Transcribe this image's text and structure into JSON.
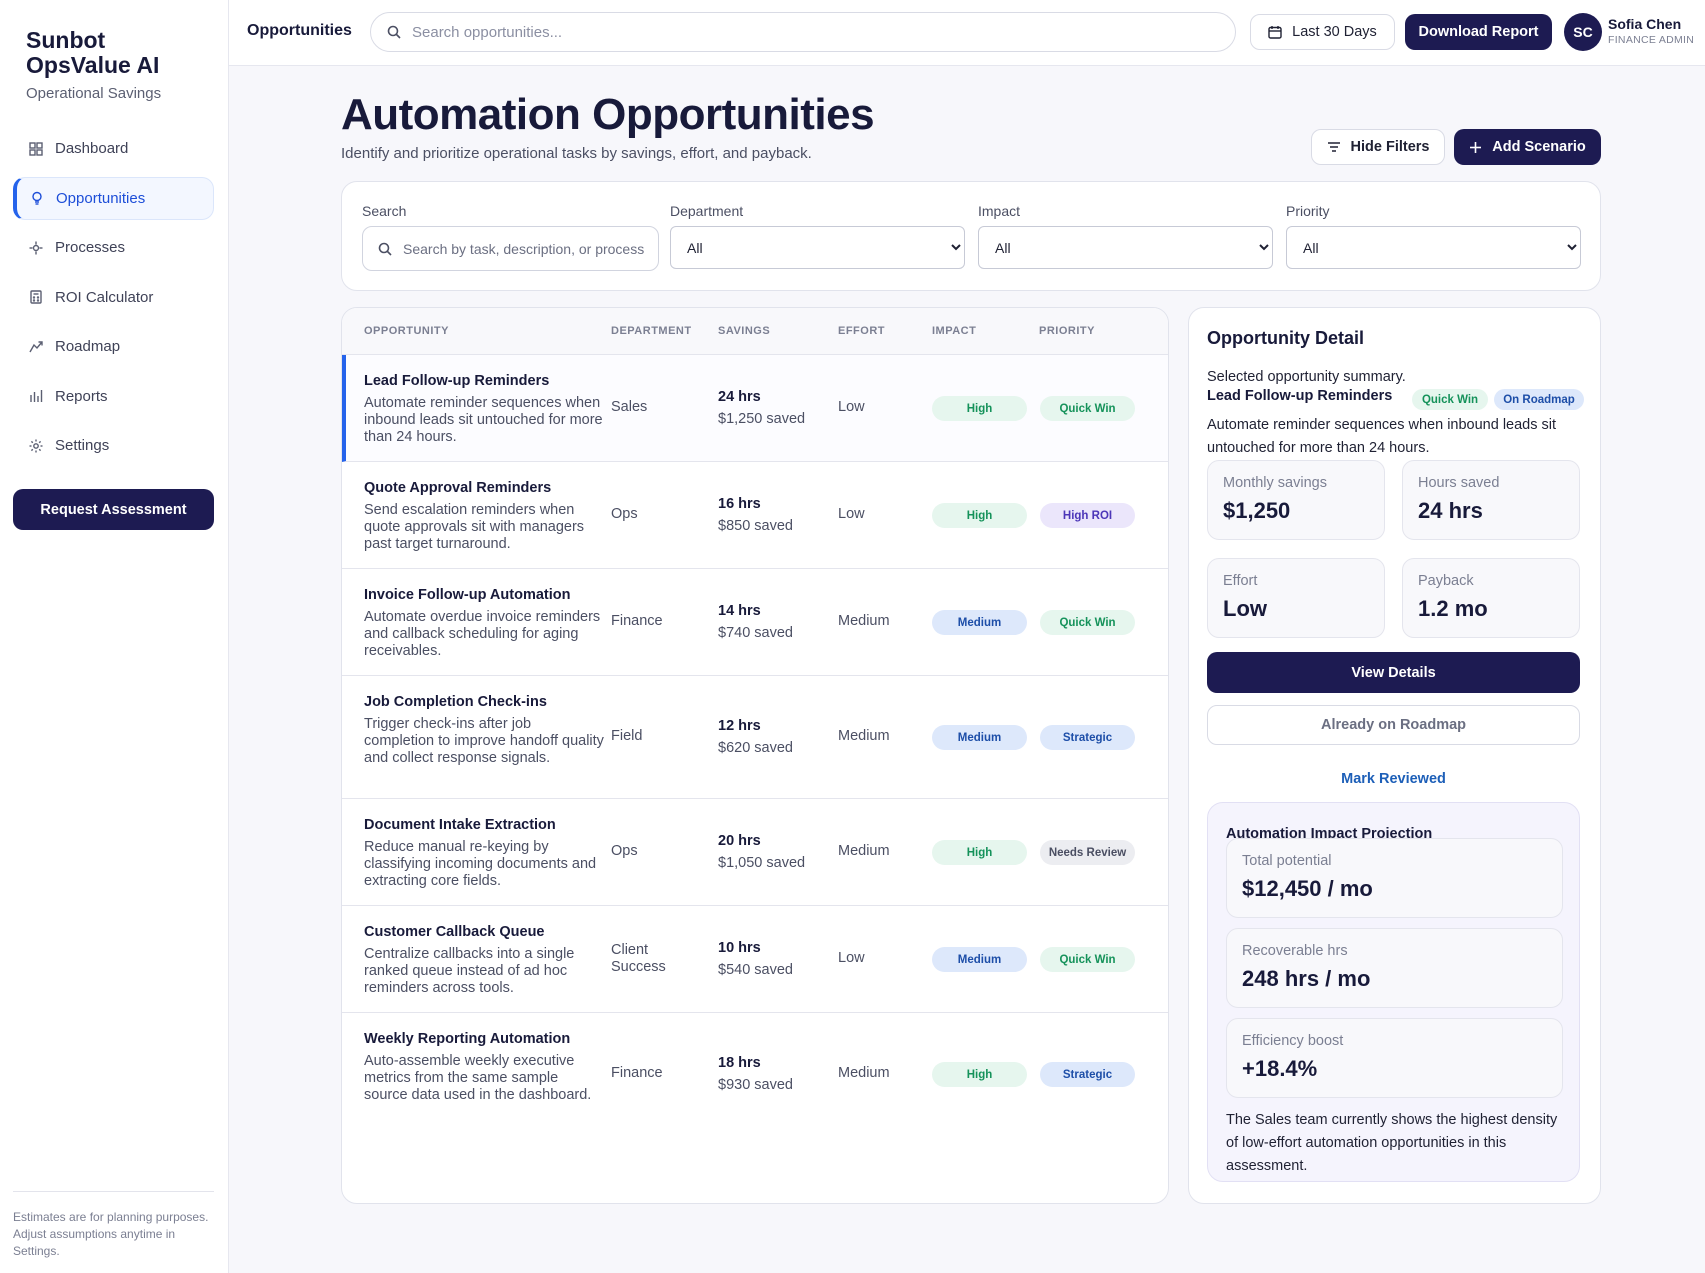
{
  "sidebar": {
    "brand_line1": "Sunbot",
    "brand_line2": "OpsValue AI",
    "brand_sub": "Operational Savings",
    "items": [
      {
        "label": "Dashboard",
        "icon": "dashboard-icon"
      },
      {
        "label": "Opportunities",
        "icon": "lightbulb-icon",
        "active": true
      },
      {
        "label": "Processes",
        "icon": "process-icon"
      },
      {
        "label": "ROI Calculator",
        "icon": "calculator-icon"
      },
      {
        "label": "Roadmap",
        "icon": "roadmap-icon"
      },
      {
        "label": "Reports",
        "icon": "bar-chart-icon"
      },
      {
        "label": "Settings",
        "icon": "gear-icon"
      }
    ],
    "request_label": "Request Assessment",
    "footer": "Estimates are for planning purposes. Adjust assumptions anytime in Settings."
  },
  "topbar": {
    "title": "Opportunities",
    "search_placeholder": "Search opportunities...",
    "date_label": "Last 30 Days",
    "download_label": "Download Report",
    "avatar_initials": "SC",
    "user_name": "Sofia Chen",
    "user_role": "FINANCE ADMIN"
  },
  "header": {
    "title": "Automation Opportunities",
    "subtitle": "Identify and prioritize operational tasks by savings, effort, and payback.",
    "hide_filters": "Hide Filters",
    "add_scenario": "Add Scenario"
  },
  "filters": {
    "search_label": "Search",
    "search_placeholder": "Search by task, description, or process",
    "department_label": "Department",
    "department_value": "All",
    "impact_label": "Impact",
    "impact_value": "All",
    "priority_label": "Priority",
    "priority_value": "All"
  },
  "table": {
    "headers": {
      "opportunity": "OPPORTUNITY",
      "department": "DEPARTMENT",
      "savings": "SAVINGS",
      "effort": "EFFORT",
      "impact": "IMPACT",
      "priority": "PRIORITY"
    },
    "rows": [
      {
        "title": "Lead Follow-up Reminders",
        "desc": "Automate reminder sequences when inbound leads sit untouched for more than 24 hours.",
        "dept": "Sales",
        "hrs": "24 hrs",
        "saved": "$1,250 saved",
        "effort": "Low",
        "impact": "High",
        "priority": "Quick Win"
      },
      {
        "title": "Quote Approval Reminders",
        "desc": "Send escalation reminders when quote approvals sit with managers past target turnaround.",
        "dept": "Ops",
        "hrs": "16 hrs",
        "saved": "$850 saved",
        "effort": "Low",
        "impact": "High",
        "priority": "High ROI"
      },
      {
        "title": "Invoice Follow-up Automation",
        "desc": "Automate overdue invoice reminders and callback scheduling for aging receivables.",
        "dept": "Finance",
        "hrs": "14 hrs",
        "saved": "$740 saved",
        "effort": "Medium",
        "impact": "Medium",
        "priority": "Quick Win"
      },
      {
        "title": "Job Completion Check-ins",
        "desc": "Trigger check-ins after job completion to improve handoff quality and collect response signals.",
        "dept": "Field",
        "hrs": "12 hrs",
        "saved": "$620 saved",
        "effort": "Medium",
        "impact": "Medium",
        "priority": "Strategic"
      },
      {
        "title": "Document Intake Extraction",
        "desc": "Reduce manual re-keying by classifying incoming documents and extracting core fields.",
        "dept": "Ops",
        "hrs": "20 hrs",
        "saved": "$1,050 saved",
        "effort": "Medium",
        "impact": "High",
        "priority": "Needs Review"
      },
      {
        "title": "Customer Callback Queue",
        "desc": "Centralize callbacks into a single ranked queue instead of ad hoc reminders across tools.",
        "dept": "Client Success",
        "hrs": "10 hrs",
        "saved": "$540 saved",
        "effort": "Low",
        "impact": "Medium",
        "priority": "Quick Win"
      },
      {
        "title": "Weekly Reporting Automation",
        "desc": "Auto-assemble weekly executive metrics from the same sample source data used in the dashboard.",
        "dept": "Finance",
        "hrs": "18 hrs",
        "saved": "$930 saved",
        "effort": "Medium",
        "impact": "High",
        "priority": "Strategic"
      }
    ]
  },
  "detail": {
    "title": "Opportunity Detail",
    "subtitle": "Selected opportunity summary.",
    "name": "Lead Follow-up Reminders",
    "badge_quick": "Quick Win",
    "badge_roadmap": "On Roadmap",
    "desc": "Automate reminder sequences when inbound leads sit untouched for more than 24 hours.",
    "monthly_label": "Monthly savings",
    "monthly_value": "$1,250",
    "hours_label": "Hours saved",
    "hours_value": "24 hrs",
    "effort_label": "Effort",
    "effort_value": "Low",
    "payback_label": "Payback",
    "payback_value": "1.2 mo",
    "view_label": "View Details",
    "roadmap_label": "Already on Roadmap",
    "mark_label": "Mark Reviewed",
    "projection": {
      "title": "Automation Impact Projection",
      "total_label": "Total potential",
      "total_value": "$12,450 / mo",
      "hrs_label": "Recoverable hrs",
      "hrs_value": "248 hrs / mo",
      "eff_label": "Efficiency boost",
      "eff_value": "+18.4%",
      "note": "The Sales team currently shows the highest density of low-effort automation opportunities in this assessment."
    }
  }
}
